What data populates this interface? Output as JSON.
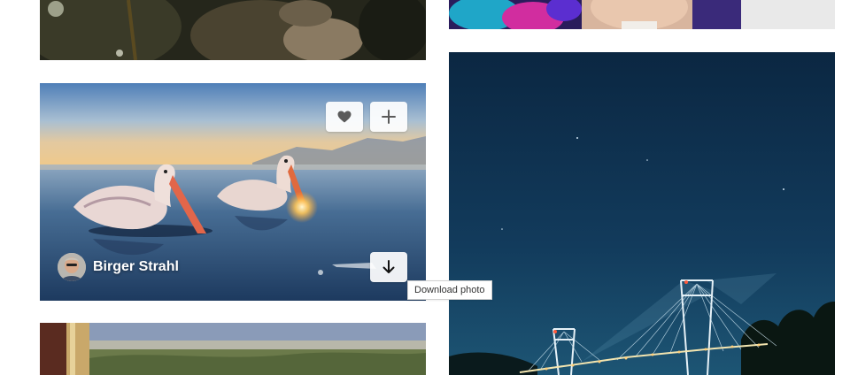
{
  "photos": [
    {
      "id": "top-left",
      "subject": "dark flower field"
    },
    {
      "id": "top-right",
      "subject": "portrait with colorful braids"
    },
    {
      "id": "pelicans",
      "subject": "two pelicans on water at sunset"
    },
    {
      "id": "bridge",
      "subject": "illuminated cable-stayed bridge at night"
    },
    {
      "id": "painting",
      "subject": "framed landscape painting"
    }
  ],
  "featured": {
    "author_name": "Birger Strahl",
    "like_icon": "heart-icon",
    "collect_icon": "plus-icon",
    "download_icon": "arrow-down-icon"
  },
  "tooltip": {
    "download": "Download photo"
  },
  "colors": {
    "button_bg": "#ffffff",
    "icon": "#555555",
    "download_icon": "#111111"
  }
}
